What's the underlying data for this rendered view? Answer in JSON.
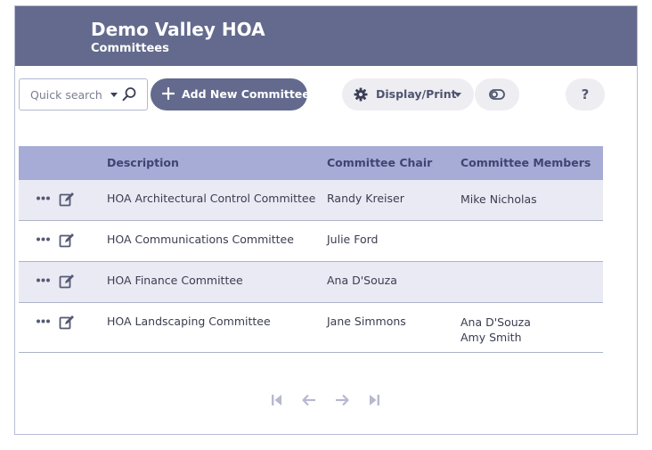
{
  "header": {
    "title": "Demo Valley HOA",
    "subtitle": "Committees"
  },
  "toolbar": {
    "search_placeholder": "Quick search",
    "add_label": "Add New Committee",
    "display_label": "Display/Print",
    "help_label": "?"
  },
  "table": {
    "columns": [
      "Description",
      "Committee Chair",
      "Committee Members"
    ],
    "rows": [
      {
        "description": "HOA Architectural Control Committee",
        "chair": "Randy Kreiser",
        "members": [
          "Mike Nicholas"
        ]
      },
      {
        "description": "HOA Communications Committee",
        "chair": "Julie Ford",
        "members": []
      },
      {
        "description": "HOA Finance Committee",
        "chair": "Ana D'Souza",
        "members": []
      },
      {
        "description": "HOA Landscaping Committee",
        "chair": "Jane Simmons",
        "members": [
          "Ana D'Souza",
          "Amy Smith"
        ]
      }
    ]
  },
  "colors": {
    "header_bg": "#636a8d",
    "table_header_bg": "#a6acd6",
    "row_shade": "#e9eaf4",
    "pager_icon": "#b6b9cf"
  },
  "icons": [
    "search-icon",
    "plus-icon",
    "gear-icon",
    "toggle-icon",
    "more-icon",
    "edit-icon",
    "first-page-icon",
    "prev-page-icon",
    "next-page-icon",
    "last-page-icon"
  ]
}
